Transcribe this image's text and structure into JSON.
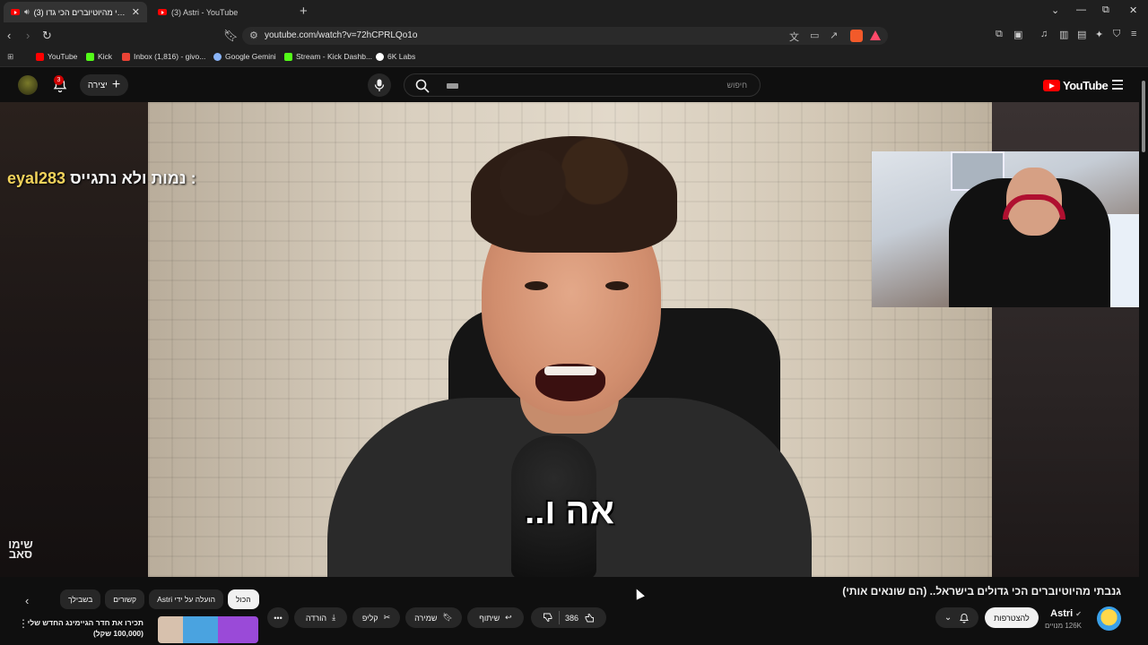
{
  "browser": {
    "tabs": [
      {
        "title": "(3) גנבתי מהיוטיוברים הכי גדו",
        "active": true
      },
      {
        "title": "(3) Astri - YouTube",
        "active": false
      }
    ],
    "new_tab_icon": "plus-icon",
    "url": "youtube.com/watch?v=72hCPRLQo1o",
    "window_controls": [
      "chevron-down-icon",
      "minimize-icon",
      "restore-icon",
      "close-icon"
    ],
    "bookmarks": [
      {
        "label": "YouTube",
        "color": "#ff0000"
      },
      {
        "label": "Kick",
        "color": "#53fc18"
      },
      {
        "label": "Inbox (1,816) - givo...",
        "color": "#ea4335"
      },
      {
        "label": "Google Gemini",
        "color": "#8ab4f8"
      },
      {
        "label": "Stream - Kick Dashb...",
        "color": "#53fc18"
      },
      {
        "label": "6K Labs",
        "color": "#ffffff"
      }
    ]
  },
  "youtube": {
    "header": {
      "notification_count": "3",
      "create_label": "יצירה",
      "search_placeholder": "חיפוש",
      "logo_text": "YouTube"
    },
    "player": {
      "subtitle": "אה ו..",
      "chat_user": "eyal283",
      "chat_message": "נמות ולא נתגייס : ",
      "watermark": "שימו סאב"
    },
    "video": {
      "title": "גנבתי מהיוטיוברים הכי גדולים בישראל.. (הם שונאים אותי)",
      "channel_name": "Astri",
      "subscribers": "126K מנויים",
      "subscribe_label": "להצטרפות",
      "like_count": "386",
      "share_label": "שיתוף",
      "save_label": "שמירה",
      "clip_label": "קליפ",
      "download_label": "הורדה"
    },
    "chips": [
      "הכול",
      "הועלה על ידי Astri",
      "קשורים",
      "בשבילך"
    ],
    "recommendation": {
      "title": "תכירו את חדר הגיימינג החדש שלי (100,000 שקל)"
    }
  },
  "colors": {
    "accent_red": "#ff0000",
    "chat_user_yellow": "#f2d35b"
  }
}
